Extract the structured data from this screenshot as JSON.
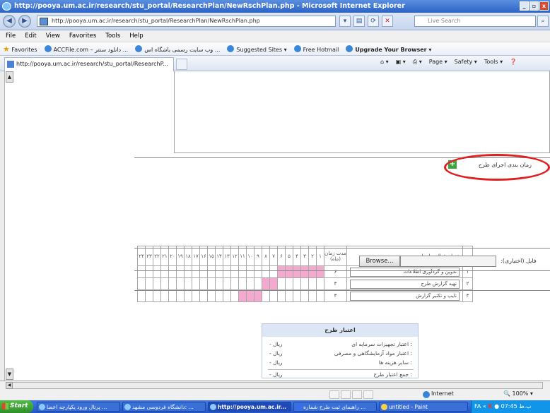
{
  "window": {
    "title": "http://pooya.um.ac.ir/research/stu_portal/ResearchPlan/NewRschPlan.php - Microsoft Internet Explorer",
    "controls": [
      "_",
      "▫",
      "x"
    ]
  },
  "address": {
    "url": "http://pooya.um.ac.ir/research/stu_portal/ResearchPlan/NewRschPlan.php",
    "search_placeholder": "Live Search"
  },
  "menu": [
    "File",
    "Edit",
    "View",
    "Favorites",
    "Tools",
    "Help"
  ],
  "favorites_bar": {
    "label": "Favorites",
    "items": [
      "ACCFile.com – دانلود سنتر ...",
      "وب سایت رسمی باشگاه اس ...",
      "Suggested Sites ▾",
      "Free Hotmail",
      "Upgrade Your Browser ▾"
    ]
  },
  "tab": {
    "label": "http://pooya.um.ac.ir/research/stu_portal/ResearchP..."
  },
  "command_bar": [
    "Page ▾",
    "Safety ▾",
    "Tools ▾"
  ],
  "schedule": {
    "title": "زمان بندی اجرای طرح",
    "headers": {
      "row": "رد",
      "activity": "عنوان فعالیت اجرایی",
      "duration": "مدت زمان (ماه)"
    },
    "months": [
      "۱",
      "۲",
      "۳",
      "۴",
      "۵",
      "۶",
      "۷",
      "۸",
      "۹",
      "۱۰",
      "۱۱",
      "۱۲",
      "۱۳",
      "۱۴",
      "۱۵",
      "۱۶",
      "۱۷",
      "۱۸",
      "۱۹",
      "۲۰",
      "۲۱",
      "۲۲",
      "۲۳",
      "۲۴"
    ],
    "rows": [
      {
        "num": "۱",
        "activity": "تدوین و گردآوری اطلاعات",
        "duration": "۶",
        "filled": [
          1,
          2,
          3,
          4,
          5,
          6
        ]
      },
      {
        "num": "۲",
        "activity": "تهیه گزارش طرح",
        "duration": "۳",
        "filled": [
          7,
          8
        ]
      },
      {
        "num": "۳",
        "activity": "تایپ و تکثیر گزارش",
        "duration": "۳",
        "filled": [
          9,
          10,
          11
        ]
      }
    ]
  },
  "file": {
    "label": "فایل (اختیاری):",
    "browse": "Browse..."
  },
  "budget": {
    "title": "اعتبار طرح",
    "rows": [
      {
        "label": "اعتبار تجهیزات سرمایه ای :",
        "value": "- ریال"
      },
      {
        "label": "اعتبار مواد آزمایشگاهی و مصرفی :",
        "value": "- ریال"
      },
      {
        "label": "سایر هزینه ها :",
        "value": "- ریال"
      },
      {
        "label": "جمع اعتبار طرح :",
        "value": "- ریال"
      }
    ]
  },
  "status": {
    "zone": "Internet",
    "zoom": "100%"
  },
  "taskbar": {
    "start": "Start",
    "tasks": [
      "پرتال ورود یکپارچه اعضا ...",
      "دانشگاه فردوسی مشهد: ...",
      "http://pooya.um.ac.ir...",
      "راهنمای ثبت طرح شماره ...",
      "untitled - Paint"
    ],
    "clock": "07:45 ب.ظ",
    "lang": "FA"
  }
}
